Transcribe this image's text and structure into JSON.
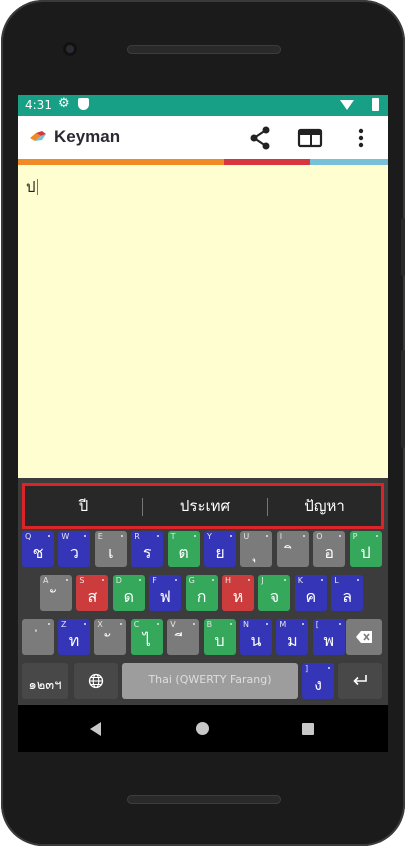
{
  "status_bar": {
    "time": "4:31"
  },
  "app_bar": {
    "title": "Keyman"
  },
  "colors": {
    "status_bar": "#17a085",
    "stripe_orange": "#f08a24",
    "stripe_red": "#d8363f",
    "stripe_blue": "#76c1d8",
    "editor_bg": "#fefed0",
    "key_blue": "#3535b8",
    "key_green": "#35a85c",
    "key_red": "#cc3c3c",
    "key_gray": "#7b7b7b",
    "suggestion_border": "#d9252a"
  },
  "editor": {
    "text": "ป"
  },
  "suggestions": [
    "ปี",
    "ประเทศ",
    "ปัญหา"
  ],
  "keyboard": {
    "layout_name": "Thai (QWERTY Farang)",
    "numbers_key": "๑๒๓ฯ",
    "globe_icon": "globe-icon",
    "backspace_icon": "backspace-icon",
    "enter_icon": "enter-icon",
    "rows": [
      [
        {
          "hint": "Q",
          "glyph": "ช",
          "color": "blue"
        },
        {
          "hint": "W",
          "glyph": "ว",
          "color": "blue"
        },
        {
          "hint": "E",
          "glyph": "เ",
          "color": "gray"
        },
        {
          "hint": "R",
          "glyph": "ร",
          "color": "blue"
        },
        {
          "hint": "T",
          "glyph": "ต",
          "color": "green"
        },
        {
          "hint": "Y",
          "glyph": "ย",
          "color": "blue"
        },
        {
          "hint": "U",
          "glyph": "ุ",
          "color": "gray"
        },
        {
          "hint": "I",
          "glyph": "ิ",
          "color": "gray"
        },
        {
          "hint": "O",
          "glyph": "อ",
          "color": "gray"
        },
        {
          "hint": "P",
          "glyph": "ป",
          "color": "green"
        }
      ],
      [
        {
          "hint": "A",
          "glyph": "ั",
          "color": "gray"
        },
        {
          "hint": "S",
          "glyph": "ส",
          "color": "red"
        },
        {
          "hint": "D",
          "glyph": "ด",
          "color": "green"
        },
        {
          "hint": "F",
          "glyph": "ฟ",
          "color": "blue"
        },
        {
          "hint": "G",
          "glyph": "ก",
          "color": "green"
        },
        {
          "hint": "H",
          "glyph": "ห",
          "color": "red"
        },
        {
          "hint": "J",
          "glyph": "จ",
          "color": "green"
        },
        {
          "hint": "K",
          "glyph": "ค",
          "color": "blue"
        },
        {
          "hint": "L",
          "glyph": "ล",
          "color": "blue"
        }
      ],
      [
        {
          "hint": "",
          "glyph": "่",
          "color": "gray"
        },
        {
          "hint": "Z",
          "glyph": "ท",
          "color": "blue"
        },
        {
          "hint": "X",
          "glyph": "ั",
          "color": "gray"
        },
        {
          "hint": "C",
          "glyph": "ไ",
          "color": "green"
        },
        {
          "hint": "V",
          "glyph": "ี",
          "color": "gray"
        },
        {
          "hint": "B",
          "glyph": "บ",
          "color": "green"
        },
        {
          "hint": "N",
          "glyph": "น",
          "color": "blue"
        },
        {
          "hint": "M",
          "glyph": "ม",
          "color": "blue"
        },
        {
          "hint": "[",
          "glyph": "พ",
          "color": "blue"
        }
      ],
      [
        {
          "hint": "]",
          "glyph": "ง",
          "color": "blue"
        }
      ]
    ]
  }
}
